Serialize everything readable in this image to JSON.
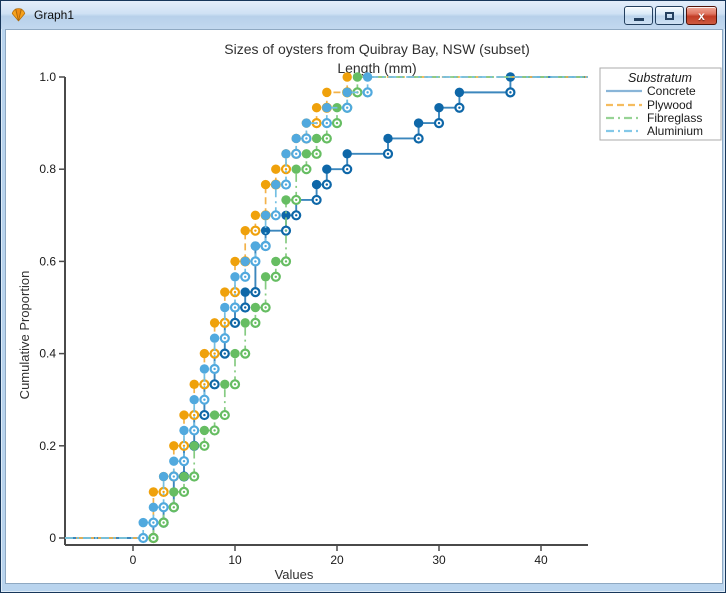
{
  "window": {
    "title": "Graph1",
    "controls": {
      "minimize": "minimize",
      "restore": "restore",
      "close": "close"
    }
  },
  "chart_data": {
    "type": "line",
    "variant": "ecdf-step",
    "title": "Sizes of oysters from Quibray Bay, NSW (subset)",
    "subtitle": "Length (mm)",
    "xlabel": "Values",
    "ylabel": "Cumulative Proportion",
    "xlim": [
      -6.5,
      44.5
    ],
    "ylim": [
      0,
      1.0
    ],
    "x_ticks": [
      0,
      10,
      20,
      30,
      40
    ],
    "x_tick_labels": [
      "0",
      "10",
      "20",
      "30",
      "40"
    ],
    "y_ticks": [
      0,
      0.2,
      0.4,
      0.6,
      0.8,
      1.0
    ],
    "y_tick_labels": [
      "0",
      "0.2",
      "0.4",
      "0.6",
      "0.8",
      "1.0"
    ],
    "grid": false,
    "legend": {
      "title": "Substratum",
      "position": "top-right"
    },
    "series": [
      {
        "name": "Concrete",
        "line_style": "solid",
        "marker_color": "#0e67a8",
        "line_color": "#3c87bd",
        "legend_color": "#89b5d8",
        "values": [
          2,
          3,
          4,
          4,
          5,
          5,
          6,
          6,
          7,
          7,
          8,
          8,
          9,
          9,
          10,
          11,
          12,
          12,
          12,
          13,
          15,
          16,
          18,
          19,
          21,
          25,
          28,
          30,
          32,
          37
        ]
      },
      {
        "name": "Plywood",
        "line_style": "dashed",
        "marker_color": "#efa10b",
        "line_color": "#f3b24a",
        "legend_color": "#f5bc5e",
        "values": [
          2,
          2,
          2,
          3,
          4,
          4,
          5,
          5,
          6,
          6,
          7,
          7,
          8,
          8,
          9,
          9,
          10,
          10,
          11,
          11,
          12,
          13,
          13,
          14,
          15,
          16,
          17,
          18,
          19,
          21
        ]
      },
      {
        "name": "Fibreglass",
        "line_style": "dashdot",
        "marker_color": "#66bd62",
        "line_color": "#86cb82",
        "legend_color": "#97d395",
        "values": [
          2,
          3,
          4,
          5,
          6,
          6,
          7,
          8,
          9,
          9,
          10,
          10,
          11,
          11,
          12,
          13,
          13,
          14,
          15,
          15,
          15,
          15,
          16,
          16,
          17,
          18,
          19,
          20,
          21,
          22
        ]
      },
      {
        "name": "Aluminium",
        "line_style": "dashdot",
        "marker_color": "#51a9de",
        "line_color": "#74bfe3",
        "legend_color": "#83c8e8",
        "values": [
          1,
          2,
          3,
          3,
          4,
          5,
          5,
          6,
          6,
          7,
          7,
          8,
          8,
          9,
          9,
          10,
          10,
          11,
          12,
          13,
          13,
          14,
          14,
          15,
          15,
          16,
          17,
          19,
          21,
          23
        ]
      }
    ]
  }
}
